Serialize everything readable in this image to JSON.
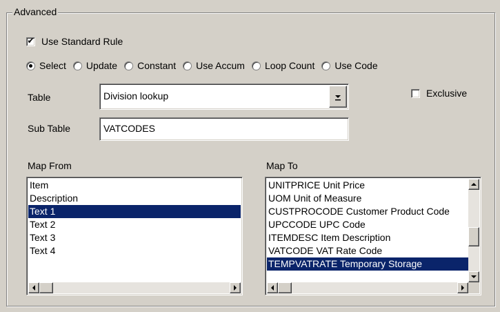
{
  "group": {
    "title": "Advanced"
  },
  "use_standard_rule": {
    "label": "Use Standard Rule",
    "checked": true
  },
  "radios": [
    {
      "label": "Select",
      "selected": true
    },
    {
      "label": "Update",
      "selected": false
    },
    {
      "label": "Constant",
      "selected": false
    },
    {
      "label": "Use Accum",
      "selected": false
    },
    {
      "label": "Loop Count",
      "selected": false
    },
    {
      "label": "Use Code",
      "selected": false
    }
  ],
  "table": {
    "label": "Table",
    "value": "Division lookup"
  },
  "exclusive": {
    "label": "Exclusive",
    "checked": false
  },
  "sub_table": {
    "label": "Sub Table",
    "value": "VATCODES"
  },
  "map_from": {
    "label": "Map From",
    "items": [
      "Item",
      "Description",
      "Text 1",
      "Text 2",
      "Text 3",
      "Text 4"
    ],
    "selected_index": 2
  },
  "map_to": {
    "label": "Map To",
    "items": [
      "UNITPRICE Unit Price",
      "UOM Unit of Measure",
      "CUSTPROCODE Customer Product Code",
      "UPCCODE UPC Code",
      "ITEMDESC Item Description",
      "VATCODE VAT Rate Code",
      "TEMPVATRATE Temporary Storage"
    ],
    "selected_index": 6
  },
  "icons": {
    "check": "check-icon",
    "dropdown": "dropdown-arrow-icon",
    "scroll_left": "arrow-left-icon",
    "scroll_right": "arrow-right-icon",
    "scroll_up": "arrow-up-icon",
    "scroll_down": "arrow-down-icon"
  },
  "colors": {
    "background": "#d4d0c8",
    "selection": "#0a246a"
  }
}
